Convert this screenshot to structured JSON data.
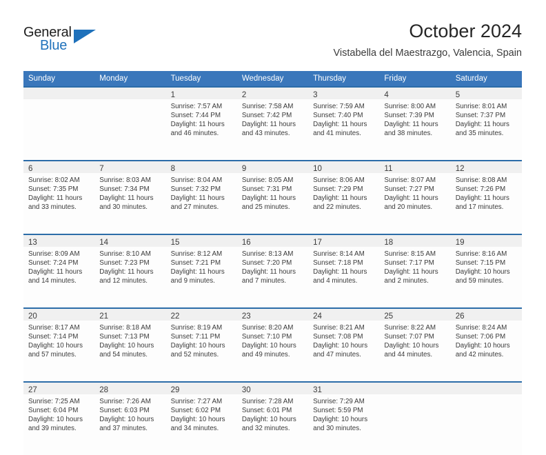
{
  "brand": {
    "name_part1": "General",
    "name_part2": "Blue",
    "icon": "triangle-flag-icon"
  },
  "header": {
    "title": "October 2024",
    "subtitle": "Vistabella del Maestrazgo, Valencia, Spain"
  },
  "colors": {
    "header_blue": "#3a77bb",
    "separator_blue": "#2b6ca8",
    "daynum_band": "#f0f0f0",
    "brand_blue": "#1f71bb",
    "text": "#3a3a3a"
  },
  "weekdays": [
    "Sunday",
    "Monday",
    "Tuesday",
    "Wednesday",
    "Thursday",
    "Friday",
    "Saturday"
  ],
  "calendar": {
    "month": "October",
    "year": 2024,
    "weeks": [
      [
        {
          "empty": true
        },
        {
          "empty": true
        },
        {
          "day": "1",
          "sunrise": "Sunrise: 7:57 AM",
          "sunset": "Sunset: 7:44 PM",
          "daylight1": "Daylight: 11 hours",
          "daylight2": "and 46 minutes."
        },
        {
          "day": "2",
          "sunrise": "Sunrise: 7:58 AM",
          "sunset": "Sunset: 7:42 PM",
          "daylight1": "Daylight: 11 hours",
          "daylight2": "and 43 minutes."
        },
        {
          "day": "3",
          "sunrise": "Sunrise: 7:59 AM",
          "sunset": "Sunset: 7:40 PM",
          "daylight1": "Daylight: 11 hours",
          "daylight2": "and 41 minutes."
        },
        {
          "day": "4",
          "sunrise": "Sunrise: 8:00 AM",
          "sunset": "Sunset: 7:39 PM",
          "daylight1": "Daylight: 11 hours",
          "daylight2": "and 38 minutes."
        },
        {
          "day": "5",
          "sunrise": "Sunrise: 8:01 AM",
          "sunset": "Sunset: 7:37 PM",
          "daylight1": "Daylight: 11 hours",
          "daylight2": "and 35 minutes."
        }
      ],
      [
        {
          "day": "6",
          "sunrise": "Sunrise: 8:02 AM",
          "sunset": "Sunset: 7:35 PM",
          "daylight1": "Daylight: 11 hours",
          "daylight2": "and 33 minutes."
        },
        {
          "day": "7",
          "sunrise": "Sunrise: 8:03 AM",
          "sunset": "Sunset: 7:34 PM",
          "daylight1": "Daylight: 11 hours",
          "daylight2": "and 30 minutes."
        },
        {
          "day": "8",
          "sunrise": "Sunrise: 8:04 AM",
          "sunset": "Sunset: 7:32 PM",
          "daylight1": "Daylight: 11 hours",
          "daylight2": "and 27 minutes."
        },
        {
          "day": "9",
          "sunrise": "Sunrise: 8:05 AM",
          "sunset": "Sunset: 7:31 PM",
          "daylight1": "Daylight: 11 hours",
          "daylight2": "and 25 minutes."
        },
        {
          "day": "10",
          "sunrise": "Sunrise: 8:06 AM",
          "sunset": "Sunset: 7:29 PM",
          "daylight1": "Daylight: 11 hours",
          "daylight2": "and 22 minutes."
        },
        {
          "day": "11",
          "sunrise": "Sunrise: 8:07 AM",
          "sunset": "Sunset: 7:27 PM",
          "daylight1": "Daylight: 11 hours",
          "daylight2": "and 20 minutes."
        },
        {
          "day": "12",
          "sunrise": "Sunrise: 8:08 AM",
          "sunset": "Sunset: 7:26 PM",
          "daylight1": "Daylight: 11 hours",
          "daylight2": "and 17 minutes."
        }
      ],
      [
        {
          "day": "13",
          "sunrise": "Sunrise: 8:09 AM",
          "sunset": "Sunset: 7:24 PM",
          "daylight1": "Daylight: 11 hours",
          "daylight2": "and 14 minutes."
        },
        {
          "day": "14",
          "sunrise": "Sunrise: 8:10 AM",
          "sunset": "Sunset: 7:23 PM",
          "daylight1": "Daylight: 11 hours",
          "daylight2": "and 12 minutes."
        },
        {
          "day": "15",
          "sunrise": "Sunrise: 8:12 AM",
          "sunset": "Sunset: 7:21 PM",
          "daylight1": "Daylight: 11 hours",
          "daylight2": "and 9 minutes."
        },
        {
          "day": "16",
          "sunrise": "Sunrise: 8:13 AM",
          "sunset": "Sunset: 7:20 PM",
          "daylight1": "Daylight: 11 hours",
          "daylight2": "and 7 minutes."
        },
        {
          "day": "17",
          "sunrise": "Sunrise: 8:14 AM",
          "sunset": "Sunset: 7:18 PM",
          "daylight1": "Daylight: 11 hours",
          "daylight2": "and 4 minutes."
        },
        {
          "day": "18",
          "sunrise": "Sunrise: 8:15 AM",
          "sunset": "Sunset: 7:17 PM",
          "daylight1": "Daylight: 11 hours",
          "daylight2": "and 2 minutes."
        },
        {
          "day": "19",
          "sunrise": "Sunrise: 8:16 AM",
          "sunset": "Sunset: 7:15 PM",
          "daylight1": "Daylight: 10 hours",
          "daylight2": "and 59 minutes."
        }
      ],
      [
        {
          "day": "20",
          "sunrise": "Sunrise: 8:17 AM",
          "sunset": "Sunset: 7:14 PM",
          "daylight1": "Daylight: 10 hours",
          "daylight2": "and 57 minutes."
        },
        {
          "day": "21",
          "sunrise": "Sunrise: 8:18 AM",
          "sunset": "Sunset: 7:13 PM",
          "daylight1": "Daylight: 10 hours",
          "daylight2": "and 54 minutes."
        },
        {
          "day": "22",
          "sunrise": "Sunrise: 8:19 AM",
          "sunset": "Sunset: 7:11 PM",
          "daylight1": "Daylight: 10 hours",
          "daylight2": "and 52 minutes."
        },
        {
          "day": "23",
          "sunrise": "Sunrise: 8:20 AM",
          "sunset": "Sunset: 7:10 PM",
          "daylight1": "Daylight: 10 hours",
          "daylight2": "and 49 minutes."
        },
        {
          "day": "24",
          "sunrise": "Sunrise: 8:21 AM",
          "sunset": "Sunset: 7:08 PM",
          "daylight1": "Daylight: 10 hours",
          "daylight2": "and 47 minutes."
        },
        {
          "day": "25",
          "sunrise": "Sunrise: 8:22 AM",
          "sunset": "Sunset: 7:07 PM",
          "daylight1": "Daylight: 10 hours",
          "daylight2": "and 44 minutes."
        },
        {
          "day": "26",
          "sunrise": "Sunrise: 8:24 AM",
          "sunset": "Sunset: 7:06 PM",
          "daylight1": "Daylight: 10 hours",
          "daylight2": "and 42 minutes."
        }
      ],
      [
        {
          "day": "27",
          "sunrise": "Sunrise: 7:25 AM",
          "sunset": "Sunset: 6:04 PM",
          "daylight1": "Daylight: 10 hours",
          "daylight2": "and 39 minutes."
        },
        {
          "day": "28",
          "sunrise": "Sunrise: 7:26 AM",
          "sunset": "Sunset: 6:03 PM",
          "daylight1": "Daylight: 10 hours",
          "daylight2": "and 37 minutes."
        },
        {
          "day": "29",
          "sunrise": "Sunrise: 7:27 AM",
          "sunset": "Sunset: 6:02 PM",
          "daylight1": "Daylight: 10 hours",
          "daylight2": "and 34 minutes."
        },
        {
          "day": "30",
          "sunrise": "Sunrise: 7:28 AM",
          "sunset": "Sunset: 6:01 PM",
          "daylight1": "Daylight: 10 hours",
          "daylight2": "and 32 minutes."
        },
        {
          "day": "31",
          "sunrise": "Sunrise: 7:29 AM",
          "sunset": "Sunset: 5:59 PM",
          "daylight1": "Daylight: 10 hours",
          "daylight2": "and 30 minutes."
        },
        {
          "empty": true
        },
        {
          "empty": true
        }
      ]
    ]
  }
}
